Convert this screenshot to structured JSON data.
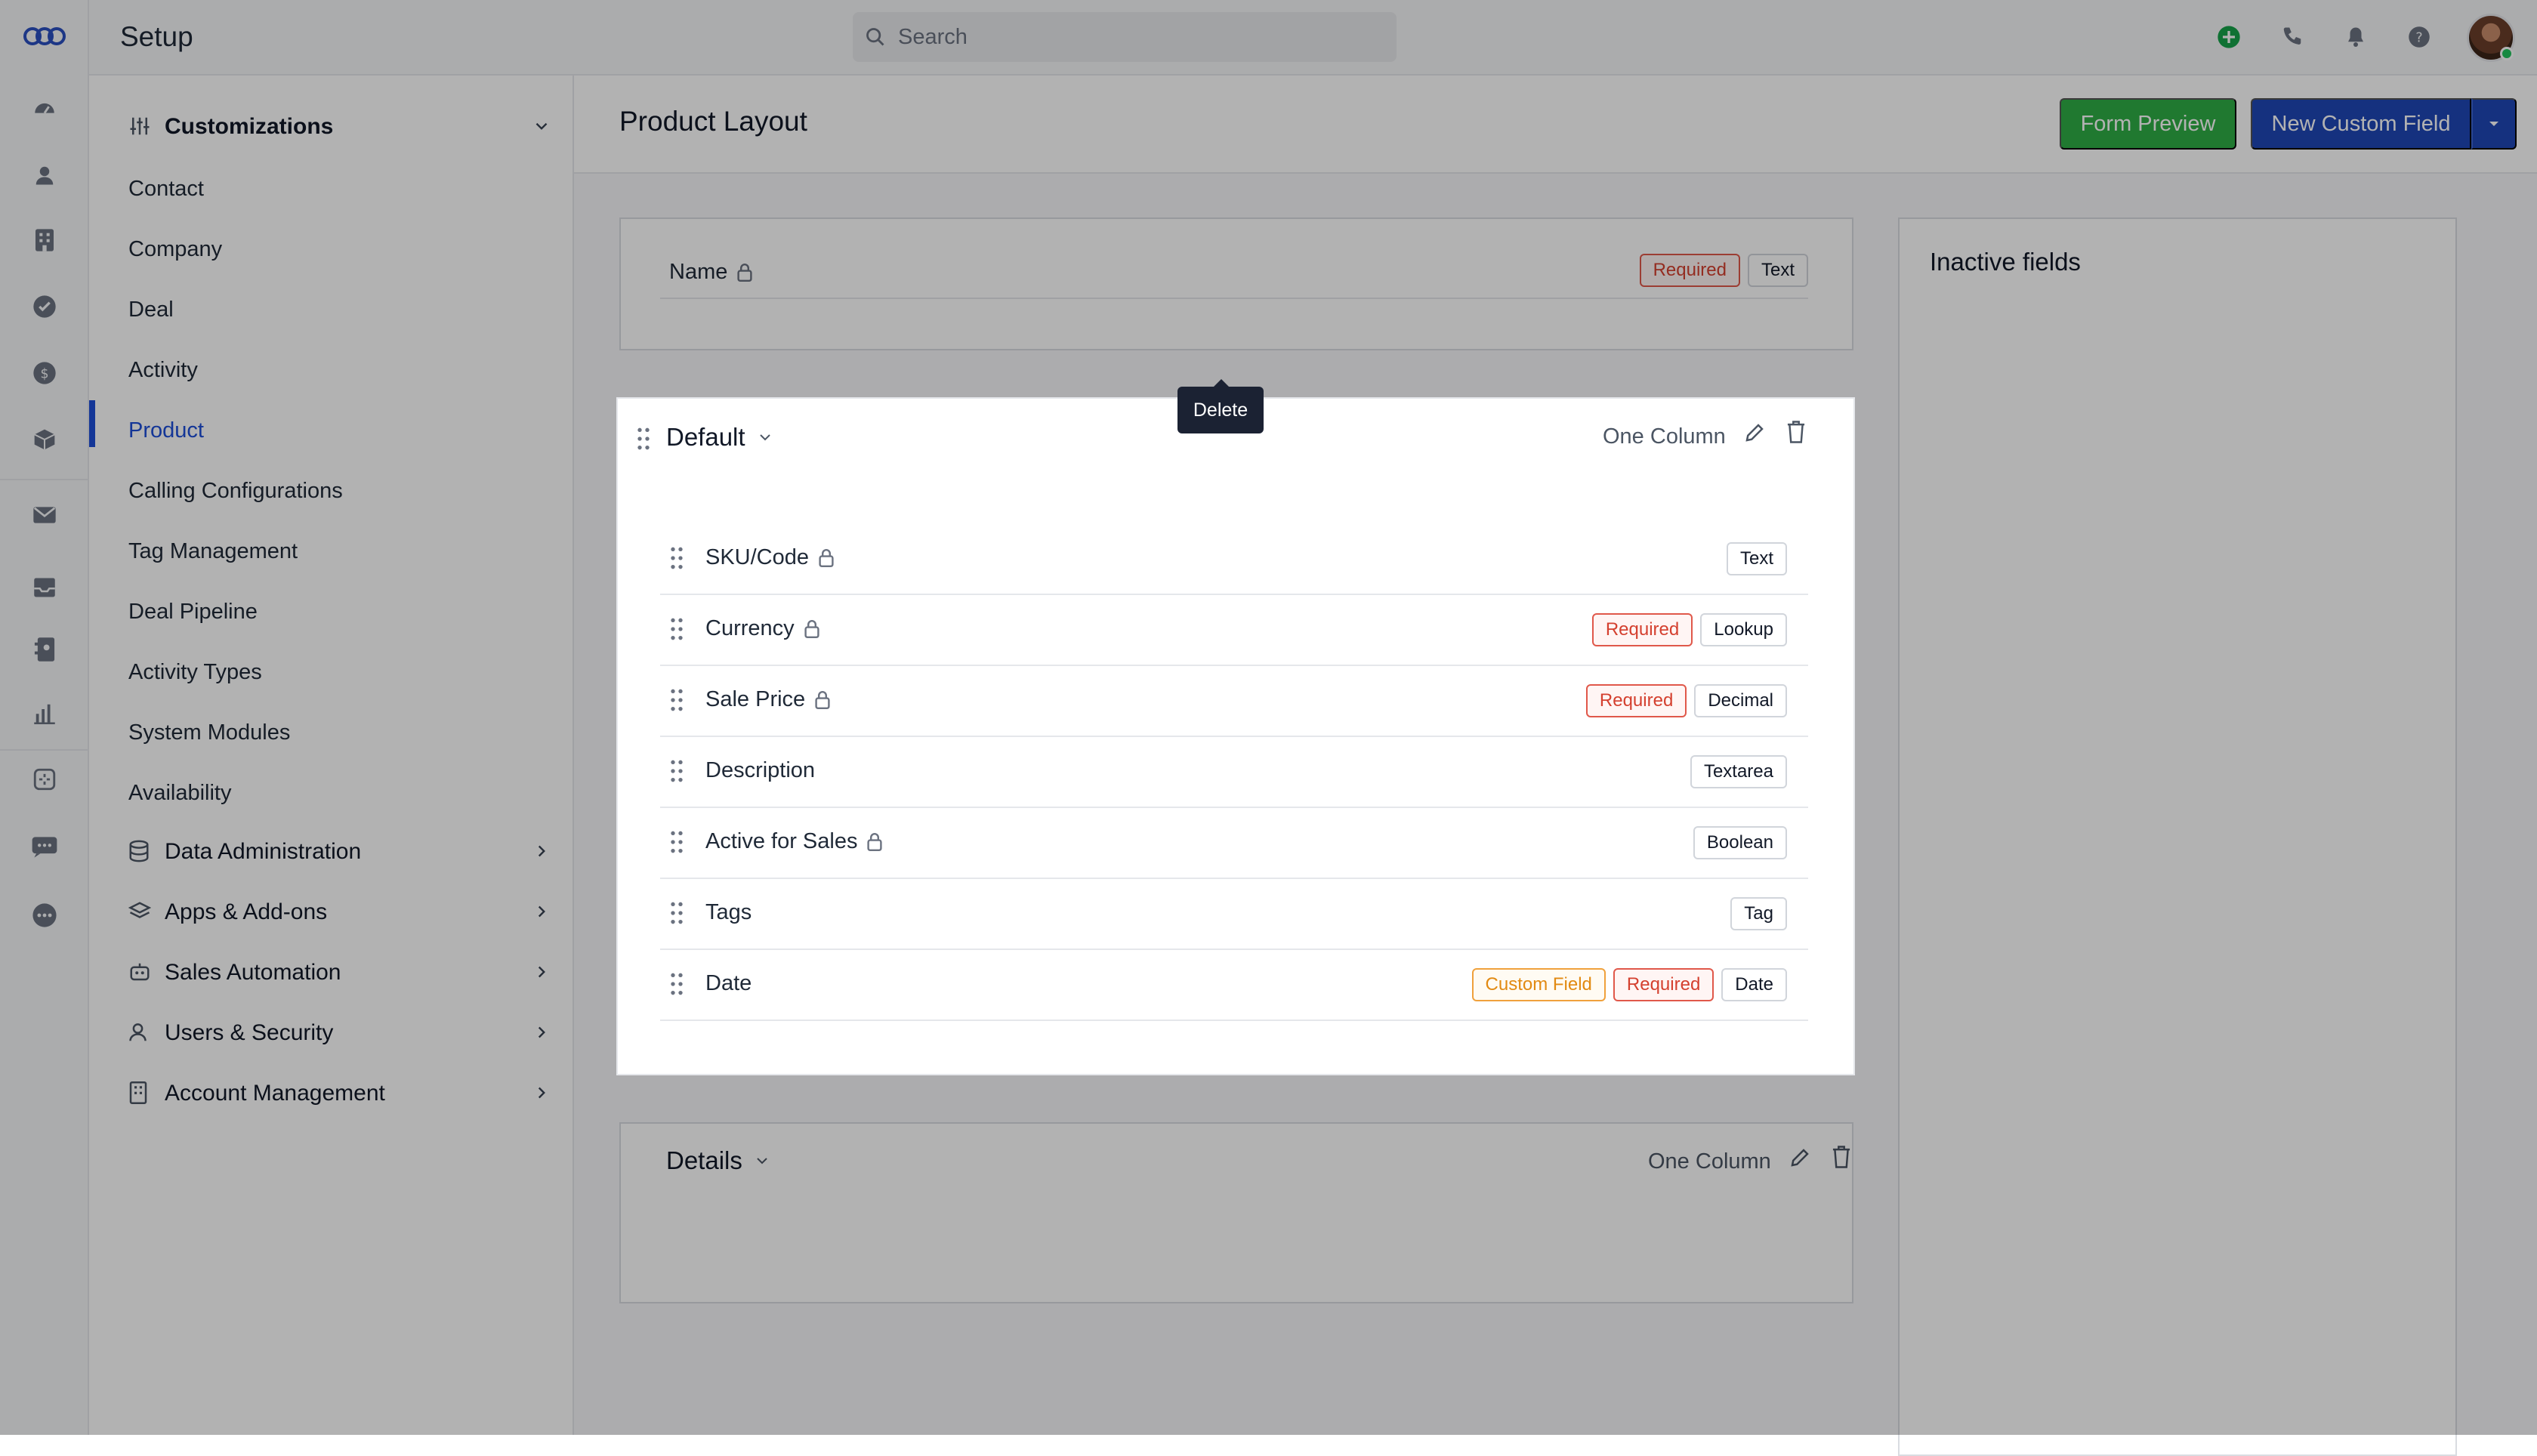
{
  "app": {
    "title": "Setup"
  },
  "header": {
    "search_placeholder": "Search"
  },
  "rail_icons": [
    "logo-icon",
    "dashboard-icon",
    "contacts-icon",
    "companies-icon",
    "tasks-icon",
    "deals-icon",
    "products-icon",
    "mail-icon",
    "inbox-icon",
    "phone-icon",
    "reports-icon",
    "automation-icon",
    "chat-icon",
    "more-icon"
  ],
  "header_icons": [
    "add-icon",
    "phone-icon",
    "bell-icon",
    "help-icon"
  ],
  "sidebar": {
    "group_customizations": "Customizations",
    "items": [
      "Contact",
      "Company",
      "Deal",
      "Activity",
      "Product",
      "Calling Configurations",
      "Tag Management",
      "Deal Pipeline",
      "Activity Types",
      "System Modules",
      "Availability"
    ],
    "active_item": "Product",
    "groups": [
      "Data Administration",
      "Apps & Add-ons",
      "Sales Automation",
      "Users & Security",
      "Account Management"
    ]
  },
  "page": {
    "title": "Product Layout",
    "form_preview_label": "Form Preview",
    "new_custom_field_label": "New Custom Field"
  },
  "name_section": {
    "field": "Name",
    "tags": [
      "Required",
      "Text"
    ]
  },
  "default_section": {
    "title": "Default",
    "layout": "One Column",
    "tooltip": "Delete",
    "fields": [
      {
        "name": "SKU/Code",
        "locked": true,
        "tags": [
          "Text"
        ]
      },
      {
        "name": "Currency",
        "locked": true,
        "tags": [
          "Required",
          "Lookup"
        ]
      },
      {
        "name": "Sale Price",
        "locked": true,
        "tags": [
          "Required",
          "Decimal"
        ]
      },
      {
        "name": "Description",
        "locked": false,
        "tags": [
          "Textarea"
        ]
      },
      {
        "name": "Active for Sales",
        "locked": true,
        "tags": [
          "Boolean"
        ]
      },
      {
        "name": "Tags",
        "locked": false,
        "tags": [
          "Tag"
        ]
      },
      {
        "name": "Date",
        "locked": false,
        "tags": [
          "Custom Field",
          "Required",
          "Date"
        ]
      }
    ]
  },
  "details_section": {
    "title": "Details",
    "layout": "One Column"
  },
  "inactive": {
    "title": "Inactive fields"
  },
  "colors": {
    "primary": "#1f47b6",
    "success": "#2fae46",
    "required": "#d4402f",
    "custom": "#e28a12",
    "tooltip": "#1b2233"
  }
}
